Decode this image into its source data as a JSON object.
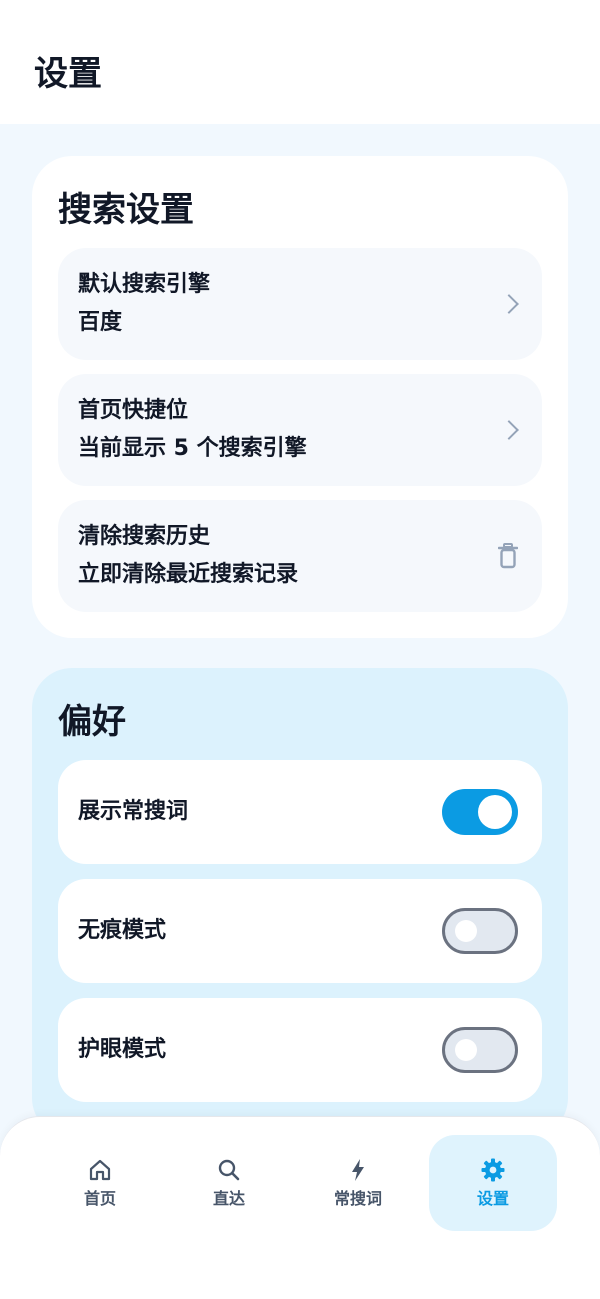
{
  "header": {
    "title": "设置"
  },
  "search_settings": {
    "title": "搜索设置",
    "items": [
      {
        "label": "默认搜索引擎",
        "value": "百度",
        "action": "chevron-right-icon"
      },
      {
        "label": "首页快捷位",
        "value": "当前显示 5 个搜索引擎",
        "action": "chevron-right-icon"
      },
      {
        "label": "清除搜索历史",
        "value": "立即清除最近搜索记录",
        "action": "trash-icon"
      }
    ]
  },
  "preferences": {
    "title": "偏好",
    "items": [
      {
        "label": "展示常搜词",
        "enabled": true
      },
      {
        "label": "无痕模式",
        "enabled": false
      },
      {
        "label": "护眼模式",
        "enabled": false
      }
    ]
  },
  "bottom_nav": {
    "items": [
      {
        "label": "首页",
        "icon": "home-icon",
        "active": false
      },
      {
        "label": "直达",
        "icon": "search-icon",
        "active": false
      },
      {
        "label": "常搜词",
        "icon": "bolt-icon",
        "active": false
      },
      {
        "label": "设置",
        "icon": "gear-icon",
        "active": true
      }
    ]
  },
  "colors": {
    "accent": "#0b9be3",
    "background": "#f1f8fe",
    "preference_card": "#dcf2fd"
  }
}
